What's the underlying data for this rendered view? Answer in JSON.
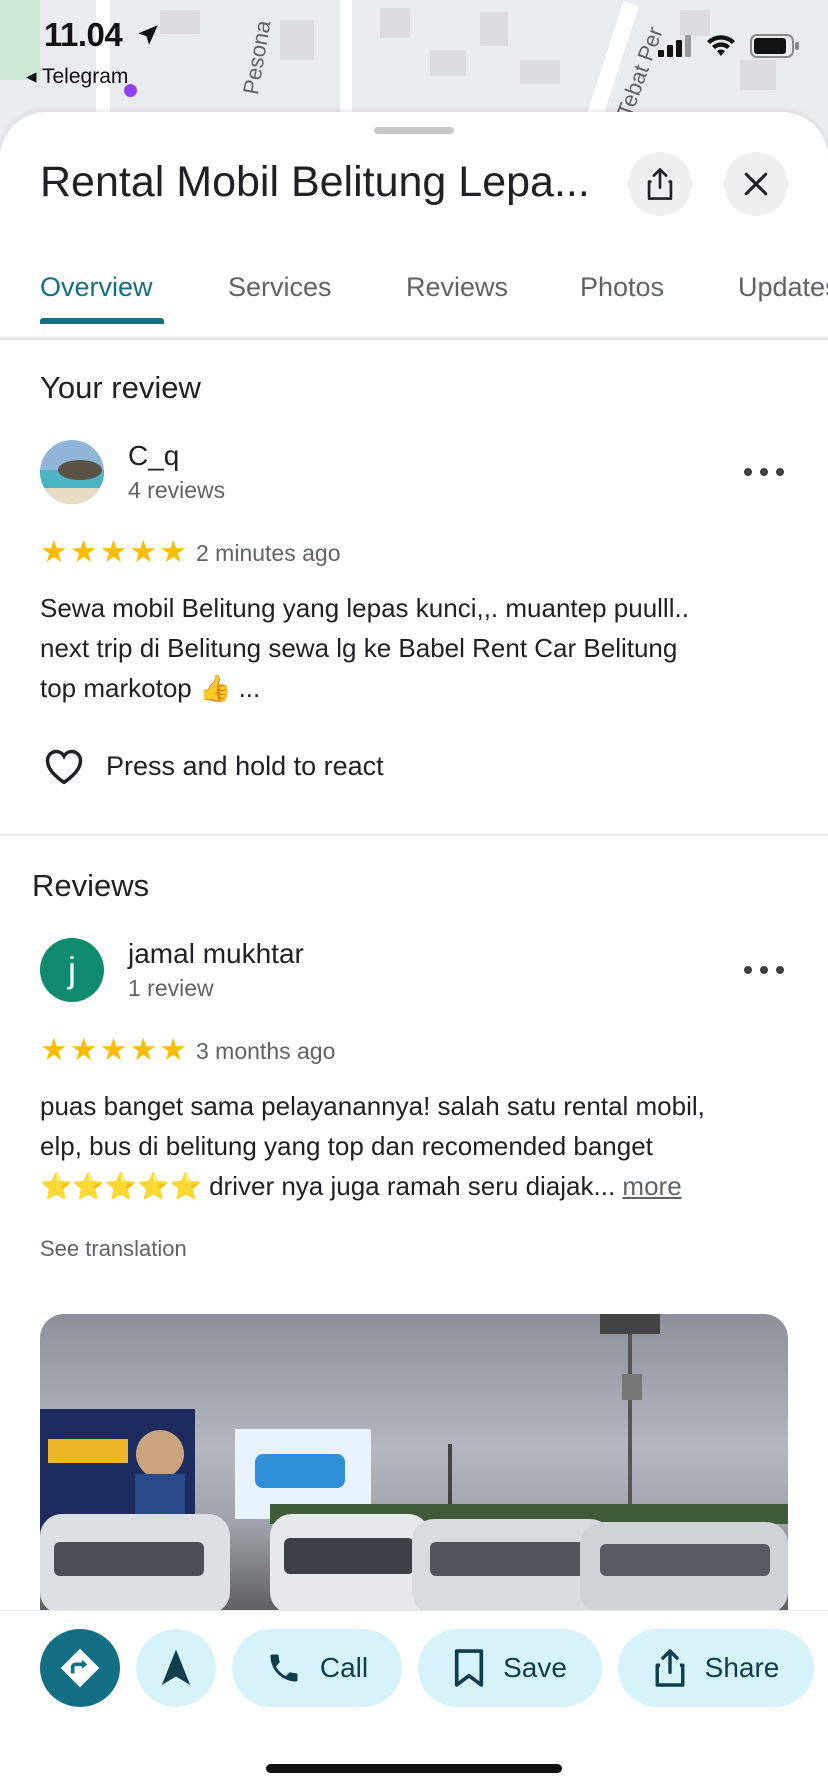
{
  "status_bar": {
    "time": "11.04",
    "back_app": "◂ Telegram"
  },
  "map_labels": [
    "Pesona",
    "Tebat Per"
  ],
  "header": {
    "title": "Rental Mobil Belitung Lepa...",
    "share_icon": "share-icon",
    "close_icon": "close-icon"
  },
  "tabs": [
    {
      "label": "Overview",
      "active": true
    },
    {
      "label": "Services"
    },
    {
      "label": "Reviews"
    },
    {
      "label": "Photos"
    },
    {
      "label": "Updates"
    }
  ],
  "your_review": {
    "heading": "Your review",
    "user_name": "C_q",
    "user_reviews": "4 reviews",
    "rating": 5,
    "time_ago": "2 minutes ago",
    "text_line1": "Sewa mobil Belitung yang lepas kunci,,. muantep puulll..",
    "text_line2": "next trip di Belitung sewa lg ke Babel Rent Car Belitung",
    "text_line3": "top markotop 👍 ...",
    "react_label": "Press and hold to react"
  },
  "reviews": {
    "heading": "Reviews",
    "items": [
      {
        "avatar_letter": "j",
        "avatar_color": "#0e8a6f",
        "user_name": "jamal mukhtar",
        "user_reviews": "1 review",
        "rating": 5,
        "time_ago": "3 months ago",
        "text_line1": "puas banget sama pelayanannya! salah satu rental mobil,",
        "text_line2": "elp, bus di belitung yang top dan recomended banget",
        "text_line3": "⭐⭐⭐⭐⭐ driver nya juga ramah seru diajak...",
        "more_label": "more",
        "translation_label": "See translation"
      }
    ]
  },
  "bottom_actions": {
    "call_label": "Call",
    "save_label": "Save",
    "share_label": "Share"
  },
  "colors": {
    "accent": "#136f84",
    "pill_bg": "#d6f3fa",
    "star": "#fbbc04"
  }
}
